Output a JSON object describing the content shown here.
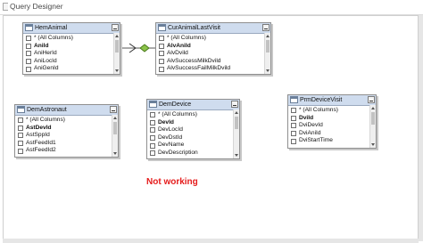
{
  "window": {
    "title": "Query Designer"
  },
  "tables": [
    {
      "name": "HemAnimal",
      "columns": [
        {
          "label": "* (All Columns)",
          "bold": false
        },
        {
          "label": "AniId",
          "bold": true
        },
        {
          "label": "AniHerId",
          "bold": false
        },
        {
          "label": "AniLocId",
          "bold": false
        },
        {
          "label": "AniGenId",
          "bold": false
        }
      ]
    },
    {
      "name": "CurAnimalLastVisit",
      "columns": [
        {
          "label": "* (All Columns)",
          "bold": false
        },
        {
          "label": "AlvAniId",
          "bold": true
        },
        {
          "label": "AlvDvild",
          "bold": false
        },
        {
          "label": "AlvSuccessMilkDvild",
          "bold": false
        },
        {
          "label": "AlvSuccessFailMilkDvild",
          "bold": false
        }
      ]
    },
    {
      "name": "DemAstronaut",
      "columns": [
        {
          "label": "* (All Columns)",
          "bold": false
        },
        {
          "label": "AstDevId",
          "bold": true
        },
        {
          "label": "AstSppId",
          "bold": false
        },
        {
          "label": "AstFeedId1",
          "bold": false
        },
        {
          "label": "AstFeedId2",
          "bold": false
        }
      ]
    },
    {
      "name": "DemDevice",
      "columns": [
        {
          "label": "* (All Columns)",
          "bold": false
        },
        {
          "label": "DevId",
          "bold": true
        },
        {
          "label": "DevLocId",
          "bold": false
        },
        {
          "label": "DevDstId",
          "bold": false
        },
        {
          "label": "DevName",
          "bold": false
        },
        {
          "label": "DevDescription",
          "bold": false
        }
      ]
    },
    {
      "name": "PrmDeviceVisit",
      "columns": [
        {
          "label": "* (All Columns)",
          "bold": false
        },
        {
          "label": "DviId",
          "bold": true
        },
        {
          "label": "DviDevId",
          "bold": false
        },
        {
          "label": "DviAniId",
          "bold": false
        },
        {
          "label": "DviStartTime",
          "bold": false
        }
      ]
    }
  ],
  "annotation": {
    "text": "Not working",
    "color": "#e51c1c"
  },
  "colors": {
    "title_bar": "#cfdcee",
    "border": "#8f8f8f"
  }
}
